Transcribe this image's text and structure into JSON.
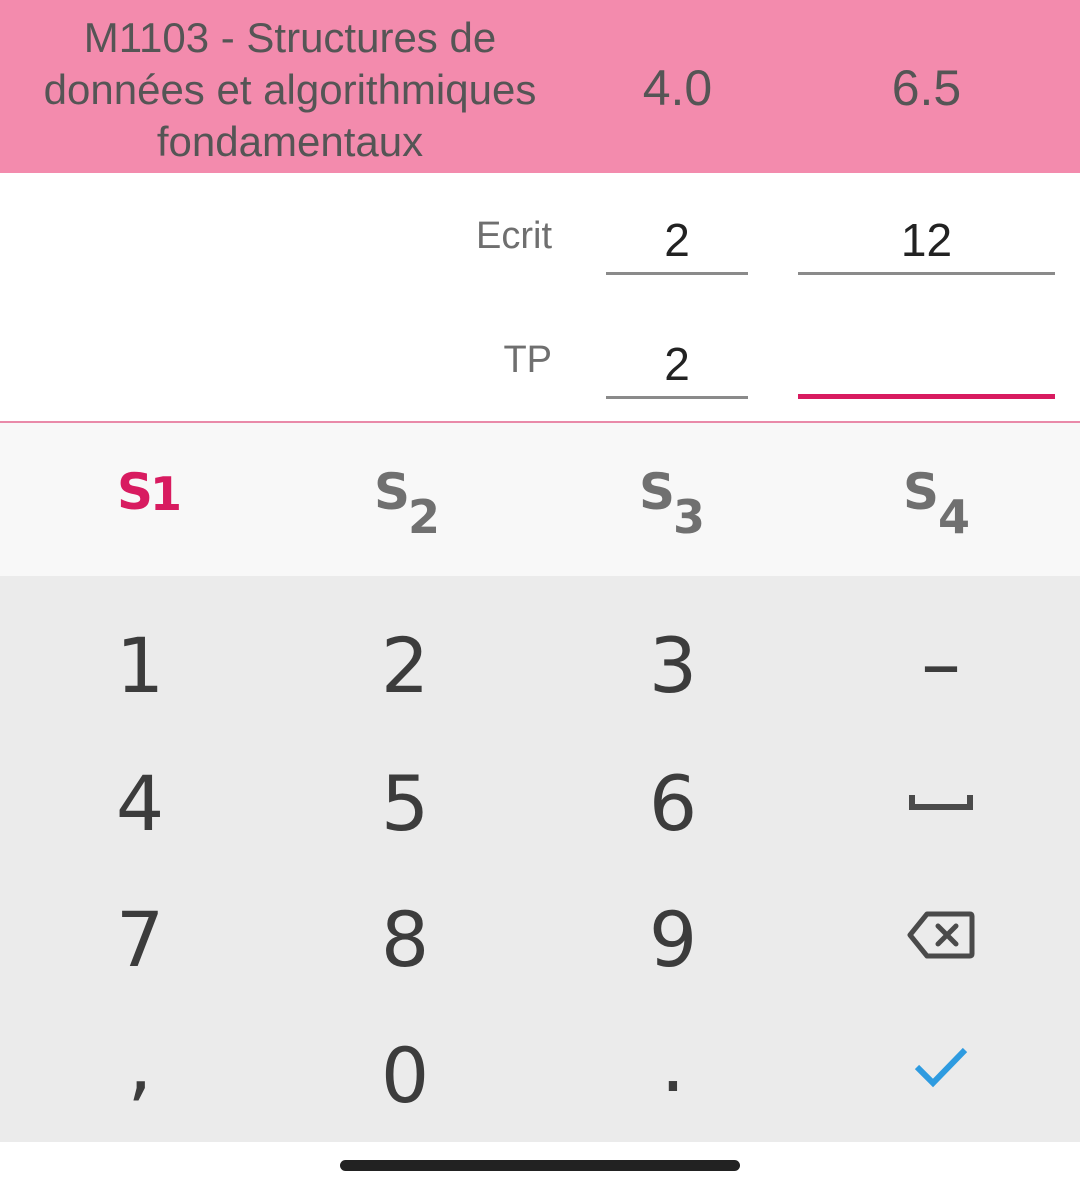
{
  "module": {
    "title": "M1103 - Structures de données et algorithmiques fondamentaux",
    "coefficient": "4.0",
    "average": "6.5"
  },
  "grades": [
    {
      "label": "Ecrit",
      "coefficient": "2",
      "mark": "12"
    },
    {
      "label": "TP",
      "coefficient": "2",
      "mark": ""
    }
  ],
  "semesters": {
    "active_index": 0,
    "active_color": "#d81b60",
    "inactive_color": "#707070",
    "tabs": [
      {
        "letter": "S",
        "number": "1"
      },
      {
        "letter": "S",
        "number": "2"
      },
      {
        "letter": "S",
        "number": "3"
      },
      {
        "letter": "S",
        "number": "4"
      }
    ]
  },
  "keyboard": {
    "digits": [
      "1",
      "2",
      "3",
      "4",
      "5",
      "6",
      "7",
      "8",
      "9",
      "0"
    ],
    "comma": ",",
    "period": ".",
    "minus": "–",
    "space_icon": "space-bar-icon",
    "backspace_icon": "backspace-icon",
    "done_icon": "checkmark-icon",
    "done_color": "#2e9be0"
  },
  "colors": {
    "header_bg": "#f38bad",
    "accent": "#d81b60",
    "keyboard_bg": "#ebebeb"
  }
}
